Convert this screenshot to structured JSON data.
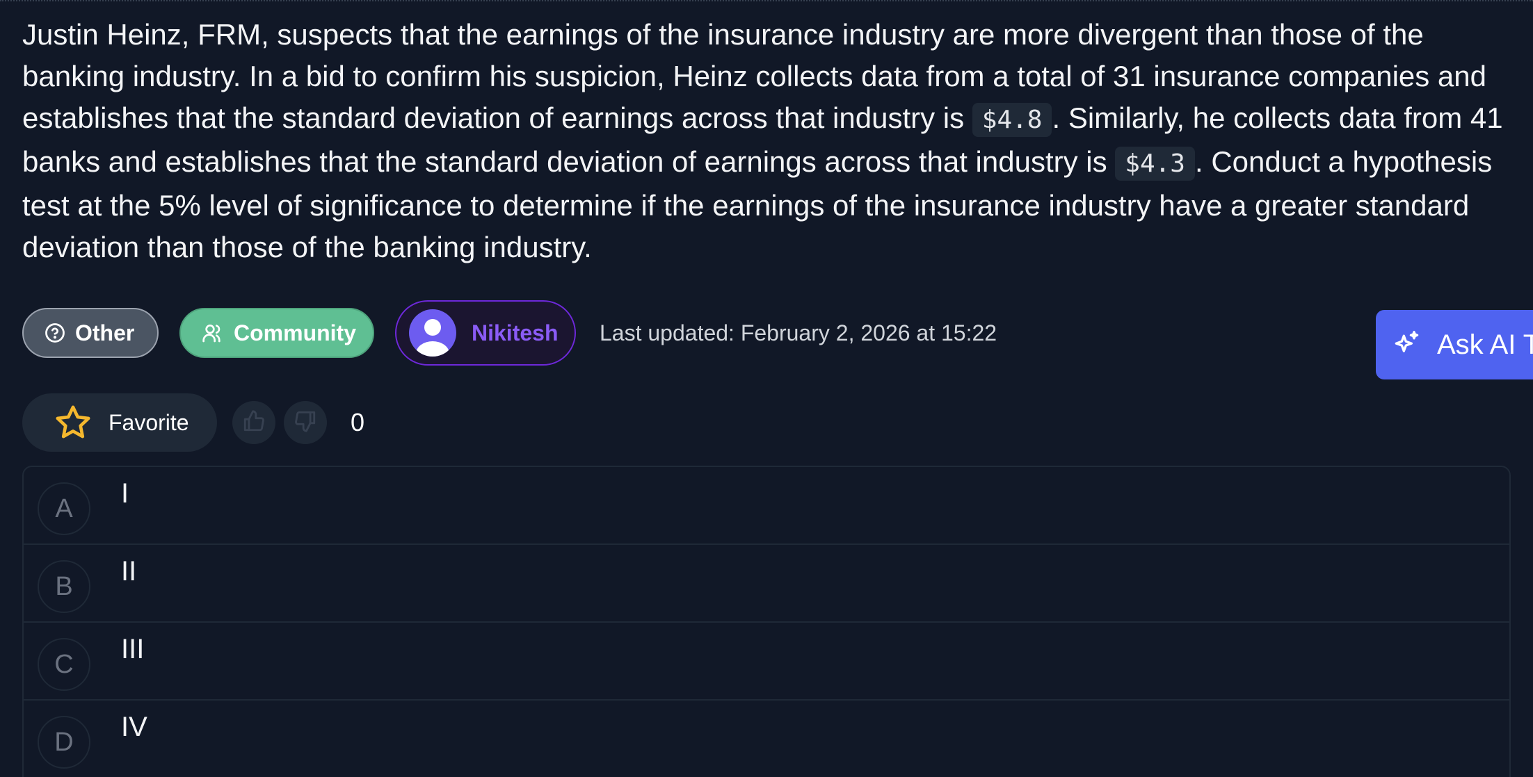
{
  "question": {
    "text_part1": "Justin Heinz, FRM, suspects that the earnings of the insurance industry are more divergent than those of the banking industry. In a bid to confirm his suspicion, Heinz collects data from a total of 31 insurance companies and establishes that the standard deviation of earnings across that industry is ",
    "code1": "$4.8",
    "text_part2": ". Similarly, he collects data from 41 banks and establishes that the standard deviation of earnings across that industry is ",
    "code2": "$4.3",
    "text_part3": ". Conduct a hypothesis test at the 5% level of significance to determine if the earnings of the insurance industry have a greater standard deviation than those of the banking industry."
  },
  "tags": {
    "category_label": "Other",
    "category_icon": "question-circle-icon",
    "source_label": "Community",
    "source_icon": "users-icon",
    "author_name": "Nikitesh",
    "author_icon": "user-avatar-icon"
  },
  "last_updated": "Last updated: February 2, 2026 at 15:22",
  "ask_ai": {
    "label": "Ask AI T",
    "icon": "sparkles-icon"
  },
  "actions": {
    "favorite_label": "Favorite",
    "favorite_icon": "star-icon",
    "upvote_icon": "thumbs-up-icon",
    "downvote_icon": "thumbs-down-icon",
    "vote_count": "0"
  },
  "options": [
    {
      "letter": "A",
      "text": "I"
    },
    {
      "letter": "B",
      "text": "II"
    },
    {
      "letter": "C",
      "text": "III"
    },
    {
      "letter": "D",
      "text": "IV"
    }
  ],
  "colors": {
    "background": "#111827",
    "accent_purple": "#8b5cf6",
    "community_green": "#5fbf93",
    "ask_ai_blue": "#4f63f0",
    "star_gold": "#f5b82e"
  }
}
